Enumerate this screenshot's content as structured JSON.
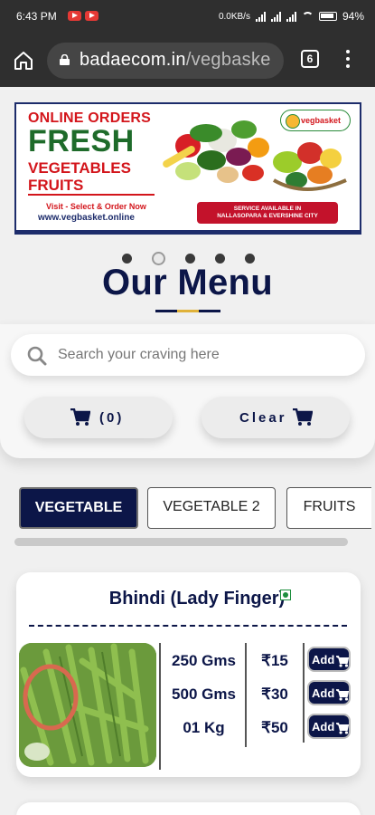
{
  "status": {
    "time": "6:43 PM",
    "network_speed": "0.0KB/s",
    "battery": "94%"
  },
  "browser": {
    "url_host": "badaecom.in",
    "url_path": "/vegbaske",
    "tab_count": "6"
  },
  "banner": {
    "line1": "ONLINE ORDERS",
    "line2": "FRESH",
    "line3": "VEGETABLES",
    "line4": "FRUITS",
    "tagline": "Visit - Select & Order Now",
    "website": "www.vegbasket.online",
    "logo": "vegbasket",
    "service_line1": "SERVICE AVAILABLE IN",
    "service_line2": "NALLASOPARA & EVERSHINE CITY"
  },
  "carousel": {
    "dots": 5,
    "active_index": 1
  },
  "menu": {
    "heading": "Our Menu",
    "search_placeholder": "Search your craving here",
    "cart_label": "(0)",
    "clear_label": "Clear"
  },
  "categories": [
    "VEGETABLE",
    "VEGETABLE 2",
    "FRUITS"
  ],
  "product": {
    "name": "Bhindi (Lady Finger)",
    "variants": [
      {
        "qty": "250 Gms",
        "price": "₹15",
        "add": "Add"
      },
      {
        "qty": "500 Gms",
        "price": "₹30",
        "add": "Add"
      },
      {
        "qty": "01 Kg",
        "price": "₹50",
        "add": "Add"
      }
    ]
  },
  "colors": {
    "primary": "#0c1648",
    "accent_gold": "#e0b23a",
    "veg_green": "#1e8e3e",
    "browser_bar": "#2f2f2f"
  }
}
